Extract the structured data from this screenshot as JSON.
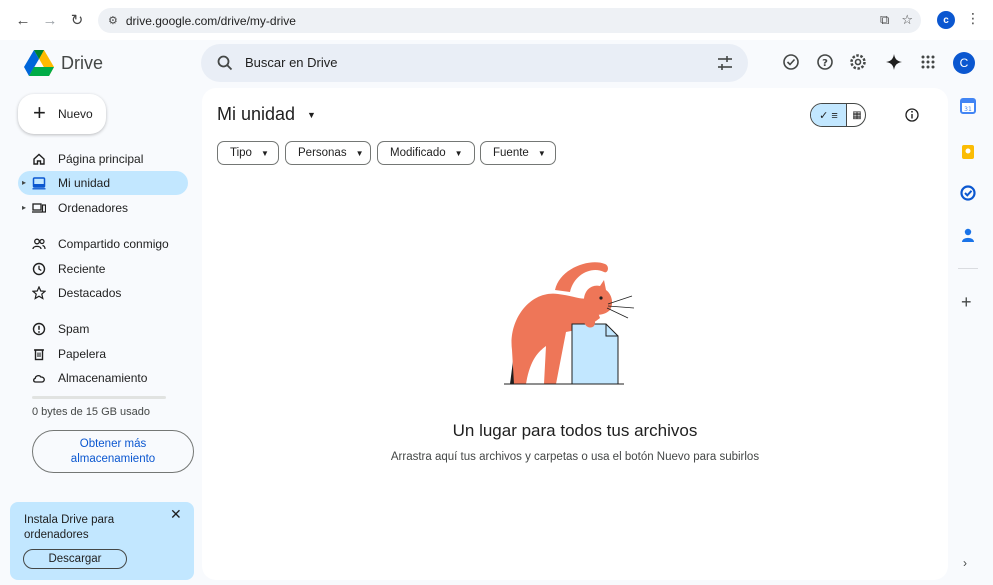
{
  "browser": {
    "url": "drive.google.com/drive/my-drive",
    "profile_initial": "c"
  },
  "app": {
    "name": "Drive",
    "search_placeholder": "Buscar en Drive",
    "avatar_initial": "C"
  },
  "sidebar": {
    "new_label": "Nuevo",
    "items": [
      {
        "label": "Página principal",
        "icon": "home-icon"
      },
      {
        "label": "Mi unidad",
        "icon": "my-drive-icon",
        "active": true
      },
      {
        "label": "Ordenadores",
        "icon": "computers-icon"
      },
      {
        "label": "Compartido conmigo",
        "icon": "shared-icon"
      },
      {
        "label": "Reciente",
        "icon": "clock-icon"
      },
      {
        "label": "Destacados",
        "icon": "star-icon"
      },
      {
        "label": "Spam",
        "icon": "spam-icon"
      },
      {
        "label": "Papelera",
        "icon": "trash-icon"
      },
      {
        "label": "Almacenamiento",
        "icon": "cloud-icon"
      }
    ],
    "storage_text": "0 bytes de 15 GB usado",
    "storage_used_fraction": 0,
    "more_storage_line1": "Obtener más",
    "more_storage_line2": "almacenamiento",
    "promo": {
      "text_line1": "Instala Drive para",
      "text_line2": "ordenadores",
      "button": "Descargar"
    }
  },
  "main": {
    "title": "Mi unidad",
    "filters": [
      "Tipo",
      "Personas",
      "Modificado",
      "Fuente"
    ],
    "empty_title": "Un lugar para todos tus archivos",
    "empty_subtitle": "Arrastra aquí tus archivos y carpetas o usa el botón Nuevo para subirlos"
  },
  "colors": {
    "accent": "#0b57d0",
    "active_bg": "#c2e7ff",
    "search_bg": "#e9eef6",
    "page_bg": "#f8fafd"
  }
}
